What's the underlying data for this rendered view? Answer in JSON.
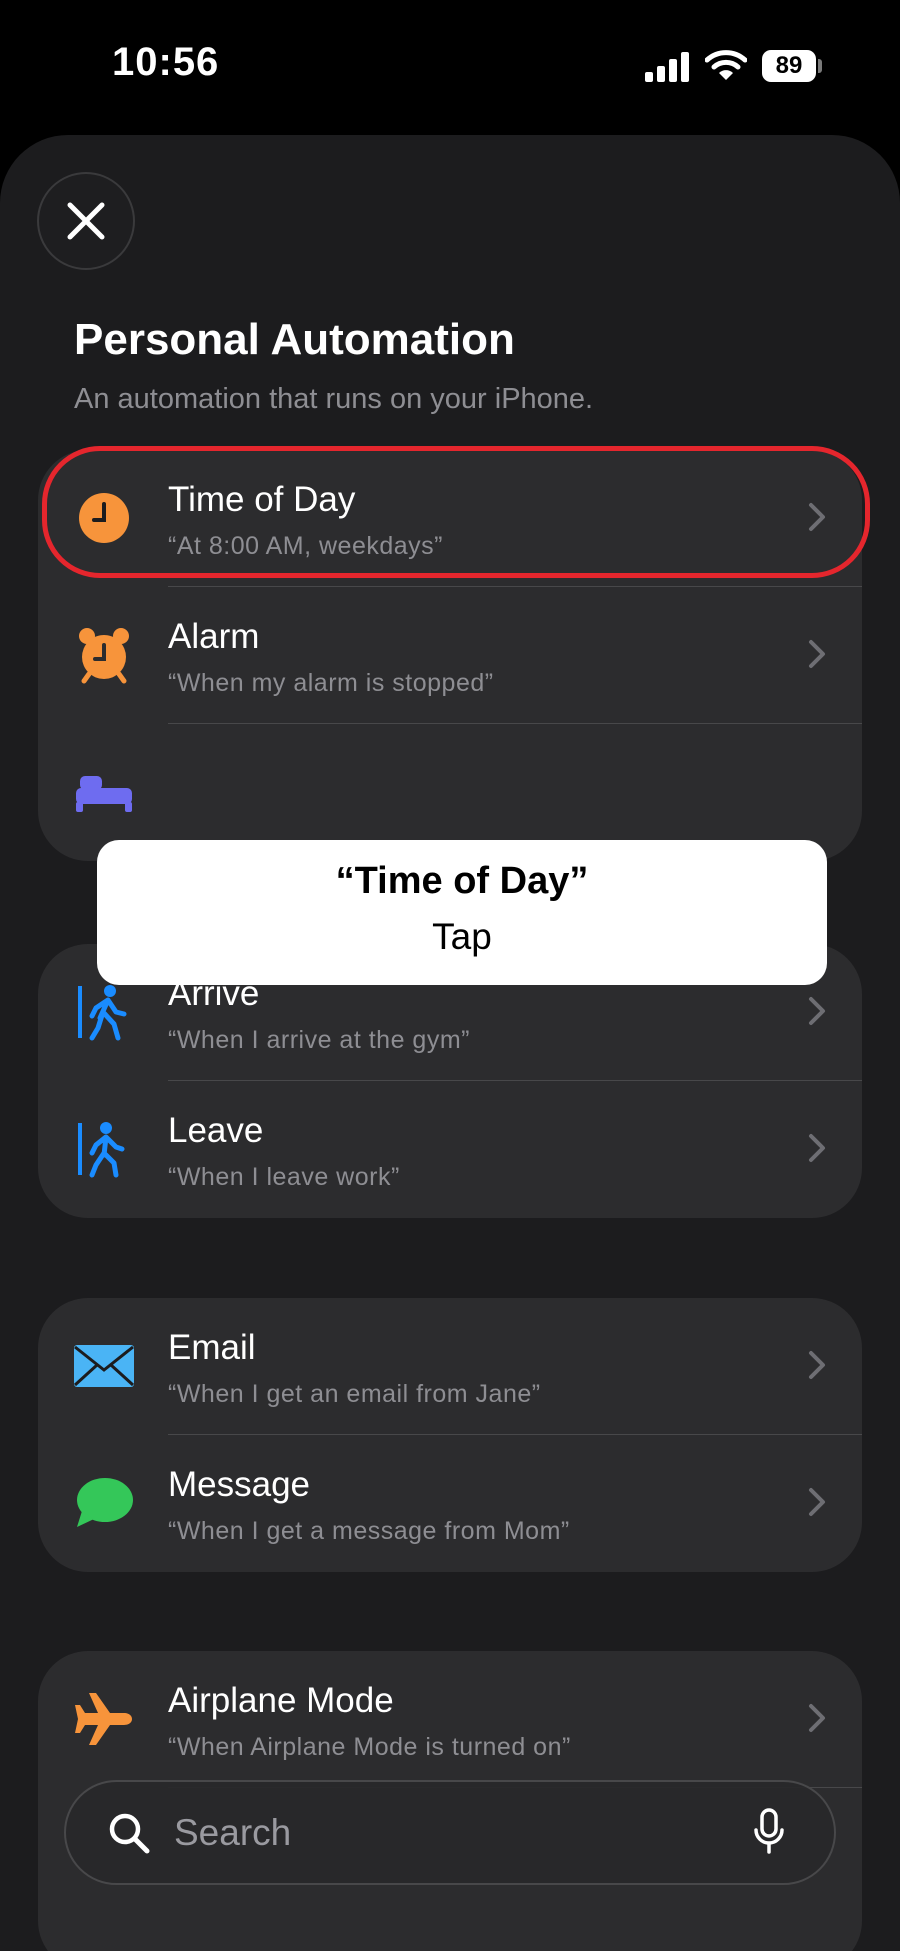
{
  "status_bar": {
    "time": "10:56",
    "battery": "89"
  },
  "sheet": {
    "title": "Personal Automation",
    "subtitle": "An automation that runs on your iPhone."
  },
  "groups": [
    {
      "items": [
        {
          "title": "Time of Day",
          "subtitle": "“At 8:00 AM, weekdays”",
          "icon": "clock-icon",
          "icon_color": "#f7943b"
        },
        {
          "title": "Alarm",
          "subtitle": "“When my alarm is stopped”",
          "icon": "alarm-clock-icon",
          "icon_color": "#f7943b"
        },
        {
          "title": "",
          "subtitle": "",
          "icon": "bed-icon",
          "icon_color": "#6e6cf0"
        }
      ]
    },
    {
      "items": [
        {
          "title": "Arrive",
          "subtitle": "“When I arrive at the gym”",
          "icon": "walking-arrive-icon",
          "icon_color": "#1a8cff"
        },
        {
          "title": "Leave",
          "subtitle": "“When I leave work”",
          "icon": "walking-leave-icon",
          "icon_color": "#1a8cff"
        }
      ]
    },
    {
      "items": [
        {
          "title": "Email",
          "subtitle": "“When I get an email from Jane”",
          "icon": "mail-icon",
          "icon_color": "#4ab4f5"
        },
        {
          "title": "Message",
          "subtitle": "“When I get a message from Mom”",
          "icon": "message-bubble-icon",
          "icon_color": "#34c759"
        }
      ]
    },
    {
      "items": [
        {
          "title": "Airplane Mode",
          "subtitle": "“When Airplane Mode is turned on”",
          "icon": "airplane-icon",
          "icon_color": "#f7943b"
        }
      ]
    }
  ],
  "tooltip": {
    "title": "“Time of Day”",
    "action": "Tap"
  },
  "search": {
    "placeholder": "Search"
  },
  "colors": {
    "highlight": "#e5262d",
    "card": "#2c2c2e",
    "sheet": "#1c1c1e"
  }
}
